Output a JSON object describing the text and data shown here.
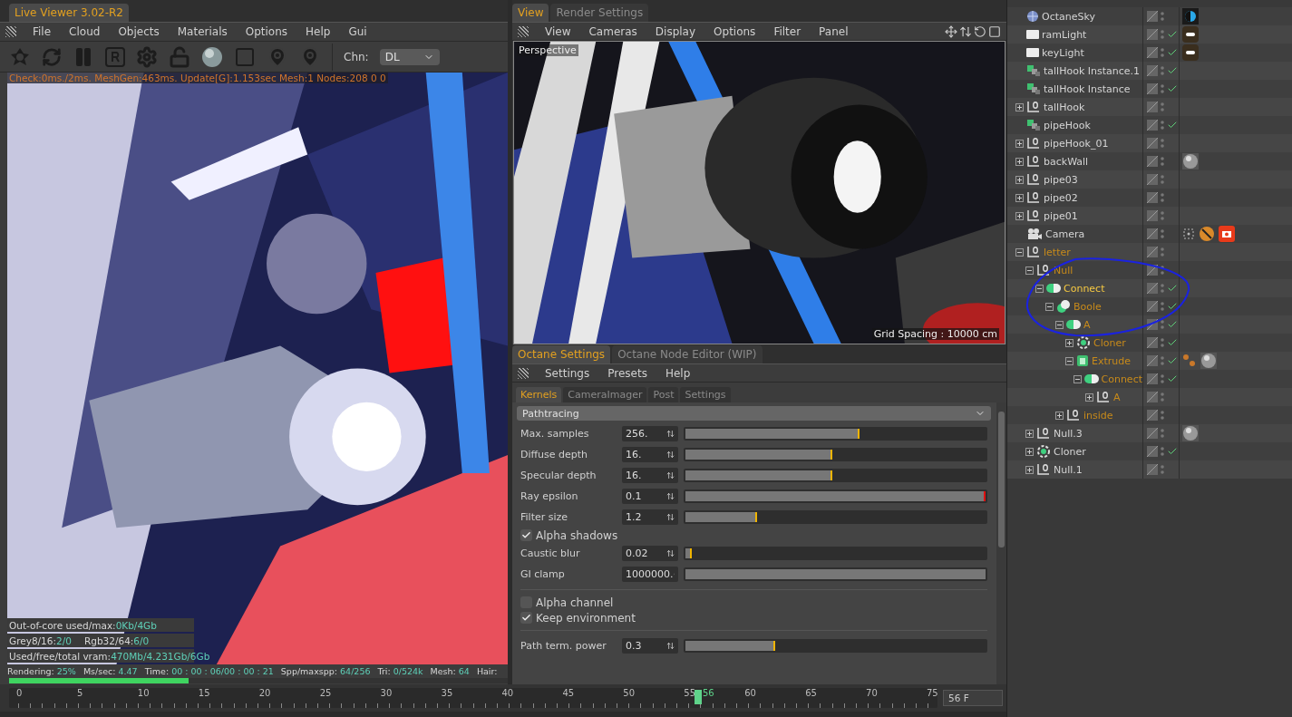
{
  "live_viewer": {
    "tab": {
      "label": "Live Viewer 3.02-R2",
      "selected": true
    },
    "menu": [
      "File",
      "Cloud",
      "Objects",
      "Materials",
      "Options",
      "Help",
      "Gui"
    ],
    "channel": {
      "label": "Chn:",
      "value": "DL"
    },
    "debug_line": "Check:0ms./2ms. MeshGen:463ms. Update[G]:1.153sec Mesh:1 Nodes:208 0 0",
    "memory_stats": [
      {
        "items": [
          {
            "label": "Out-of-core used/max:",
            "value": "0Kb/4Gb"
          }
        ]
      },
      {
        "items": [
          {
            "label": "Grey8/16:",
            "value": "2/0"
          },
          {
            "label": "Rgb32/64:",
            "value": "6/0"
          }
        ]
      },
      {
        "items": [
          {
            "label": "Used/free/total vram:",
            "value": "470Mb/4.231Gb/6Gb"
          }
        ]
      }
    ],
    "status": [
      {
        "label": "Rendering:",
        "value": "25%"
      },
      {
        "label": "Ms/sec:",
        "value": "4.47"
      },
      {
        "label": "Time:",
        "value": "00 : 00 : 06/00 : 00 : 21"
      },
      {
        "label": "Spp/maxspp:",
        "value": "64/256"
      },
      {
        "label": "Tri:",
        "value": "0/524k"
      },
      {
        "label": "Mesh:",
        "value": "64"
      },
      {
        "label": "Hair:"
      }
    ],
    "progress": {
      "level": 0.36
    }
  },
  "viewport": {
    "tabs": [
      {
        "label": "View",
        "selected": true
      },
      {
        "label": "Render Settings",
        "selected": false
      }
    ],
    "menu": [
      "View",
      "Cameras",
      "Display",
      "Options",
      "Filter",
      "Panel"
    ],
    "camera": "Perspective",
    "grid_spacing": "Grid Spacing : 10000 cm"
  },
  "octane": {
    "tabs": [
      {
        "label": "Octane Settings",
        "selected": true
      },
      {
        "label": "Octane Node Editor (WIP)",
        "selected": false
      }
    ],
    "menu": [
      "Settings",
      "Presets",
      "Help"
    ],
    "subtabs": [
      {
        "label": "Kernels",
        "selected": true
      },
      {
        "label": "CameraImager",
        "selected": false
      },
      {
        "label": "Post",
        "selected": false
      },
      {
        "label": "Settings",
        "selected": false
      }
    ],
    "kernel": "Pathtracing",
    "params": [
      {
        "kind": "slider",
        "label": "Max. samples",
        "value": "256.",
        "level": 0.58,
        "color": "#f0b400"
      },
      {
        "kind": "slider",
        "label": "Diffuse depth",
        "value": "16.",
        "level": 0.49,
        "color": "#f0b400"
      },
      {
        "kind": "slider",
        "label": "Specular depth",
        "value": "16.",
        "level": 0.49,
        "color": "#f0b400"
      },
      {
        "kind": "slider",
        "label": "Ray epsilon",
        "value": "0.1",
        "level": 1,
        "color": "#e01010"
      },
      {
        "kind": "slider",
        "label": "Filter size",
        "value": "1.2",
        "level": 0.24,
        "color": "#f0b400"
      },
      {
        "kind": "checkbox",
        "label": "Alpha shadows",
        "checked": true
      },
      {
        "kind": "slider",
        "label": "Caustic blur",
        "value": "0.02",
        "level": 0.02,
        "color": "#f0b400"
      },
      {
        "kind": "slider",
        "label": "GI clamp",
        "value": "1000000.",
        "level": 1
      },
      {
        "kind": "separator"
      },
      {
        "kind": "checkbox",
        "label": "Alpha channel",
        "checked": false
      },
      {
        "kind": "checkbox",
        "label": "Keep environment",
        "checked": true
      },
      {
        "kind": "separator"
      },
      {
        "kind": "slider",
        "label": "Path term. power",
        "value": "0.3",
        "level": 0.3,
        "color": "#f0b400"
      }
    ]
  },
  "timeline": {
    "ticks": [
      "0",
      "5",
      "10",
      "15",
      "20",
      "25",
      "30",
      "35",
      "40",
      "45",
      "50",
      "55",
      "60",
      "65",
      "70",
      "75"
    ],
    "current": {
      "label": "56",
      "level": 0.747
    },
    "frame_field": "56 F"
  },
  "objects": {
    "items": [
      {
        "name": "OctaneSky",
        "kind": "sky",
        "selected": false,
        "related": false,
        "enabled": false,
        "tags": [
          {
            "kind": "sky"
          }
        ]
      },
      {
        "name": "ramLight",
        "kind": "light",
        "selected": false,
        "related": false,
        "enabled": true,
        "tags": [
          {
            "kind": "light"
          }
        ]
      },
      {
        "name": "keyLight",
        "kind": "light",
        "selected": false,
        "related": false,
        "enabled": true,
        "tags": [
          {
            "kind": "light"
          }
        ]
      },
      {
        "name": "tallHook Instance.1",
        "kind": "instance",
        "selected": false,
        "related": false,
        "enabled": true
      },
      {
        "name": "tallHook Instance",
        "kind": "instance",
        "selected": false,
        "related": false,
        "enabled": true
      },
      {
        "name": "tallHook",
        "kind": "null",
        "expanded": false,
        "selected": false,
        "related": false,
        "enabled": false
      },
      {
        "name": "pipeHook",
        "kind": "instance",
        "selected": false,
        "related": false,
        "enabled": true
      },
      {
        "name": "pipeHook_01",
        "kind": "null",
        "expanded": false,
        "selected": false,
        "related": false,
        "enabled": false
      },
      {
        "name": "backWall",
        "kind": "null",
        "expanded": false,
        "selected": false,
        "related": false,
        "enabled": false,
        "tags": [
          {
            "kind": "material"
          }
        ]
      },
      {
        "name": "pipe03",
        "kind": "null",
        "expanded": false,
        "selected": false,
        "related": false,
        "enabled": false
      },
      {
        "name": "pipe02",
        "kind": "null",
        "expanded": false,
        "selected": false,
        "related": false,
        "enabled": false
      },
      {
        "name": "pipe01",
        "kind": "null",
        "expanded": false,
        "selected": false,
        "related": false,
        "enabled": false
      },
      {
        "name": "Camera",
        "kind": "camera",
        "selected": false,
        "related": false,
        "enabled": false,
        "tags": [
          {
            "kind": "target"
          },
          {
            "kind": "compositing"
          },
          {
            "kind": "camera"
          }
        ]
      },
      {
        "name": "letter",
        "kind": "null",
        "expanded": true,
        "selected": false,
        "related": true,
        "enabled": false,
        "children": [
          {
            "name": "Null",
            "kind": "null",
            "expanded": true,
            "selected": false,
            "related": true,
            "enabled": false,
            "children": [
              {
                "name": "Connect",
                "kind": "connect",
                "expanded": true,
                "selected": true,
                "related": false,
                "enabled": true,
                "children": [
                  {
                    "name": "Boole",
                    "kind": "boole",
                    "expanded": true,
                    "selected": false,
                    "related": true,
                    "enabled": true,
                    "children": [
                      {
                        "name": "A",
                        "kind": "connect",
                        "expanded": true,
                        "selected": false,
                        "related": true,
                        "enabled": true,
                        "children": [
                          {
                            "name": "Cloner",
                            "kind": "cloner",
                            "expanded": false,
                            "selected": false,
                            "related": true,
                            "enabled": true
                          },
                          {
                            "name": "Extrude",
                            "kind": "extrude",
                            "expanded": true,
                            "selected": false,
                            "related": true,
                            "enabled": true,
                            "tags": [
                              {
                                "kind": "dots"
                              },
                              {
                                "kind": "material"
                              }
                            ],
                            "children": [
                              {
                                "name": "Connect",
                                "kind": "connect",
                                "expanded": true,
                                "selected": false,
                                "related": true,
                                "enabled": true,
                                "children": [
                                  {
                                    "name": "A",
                                    "kind": "null",
                                    "expanded": false,
                                    "selected": false,
                                    "related": true,
                                    "enabled": false
                                  }
                                ]
                              }
                            ]
                          }
                        ]
                      },
                      {
                        "name": "inside",
                        "kind": "null",
                        "expanded": false,
                        "selected": false,
                        "related": true,
                        "enabled": false
                      }
                    ]
                  }
                ]
              }
            ]
          },
          {
            "name": "Null.3",
            "kind": "null",
            "expanded": false,
            "selected": false,
            "related": false,
            "enabled": false,
            "tags": [
              {
                "kind": "material"
              }
            ]
          },
          {
            "name": "Cloner",
            "kind": "cloner",
            "expanded": false,
            "selected": false,
            "related": false,
            "enabled": true
          },
          {
            "name": "Null.1",
            "kind": "null",
            "expanded": false,
            "selected": false,
            "related": false,
            "enabled": false
          }
        ]
      }
    ]
  }
}
